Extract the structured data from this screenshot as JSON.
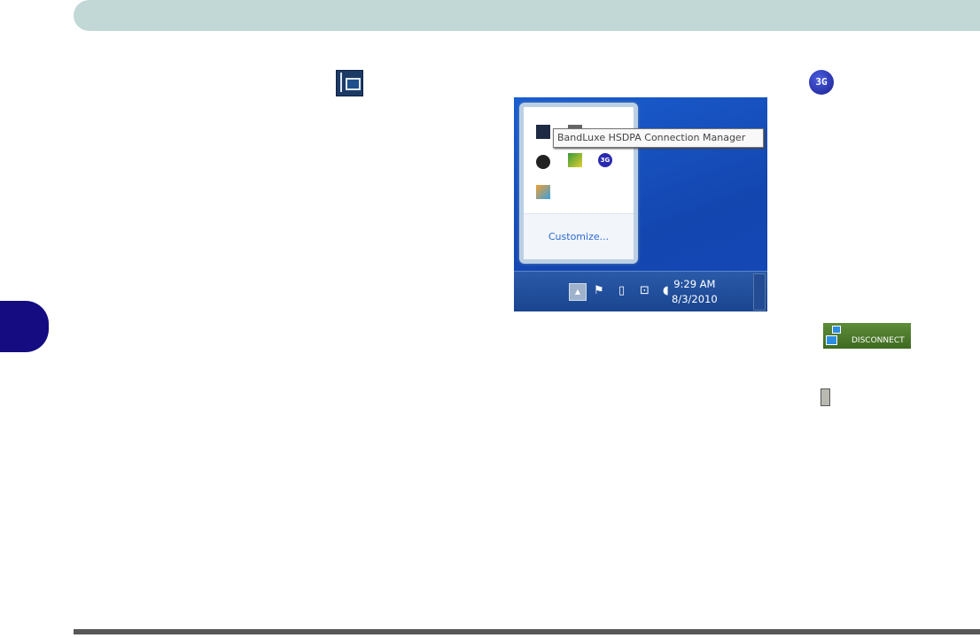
{
  "tray_popup": {
    "tooltip": "BandLuxe HSDPA Connection Manager",
    "customize_link": "Customize..."
  },
  "taskbar": {
    "time": "9:29 AM",
    "date": "8/3/2010"
  },
  "icons": {
    "three_g_label": "3G",
    "disconnect_label": "DISCONNECT"
  },
  "colors": {
    "header": "#c2d8d6",
    "chapter_tab": "#140c80",
    "footer": "#585858"
  }
}
